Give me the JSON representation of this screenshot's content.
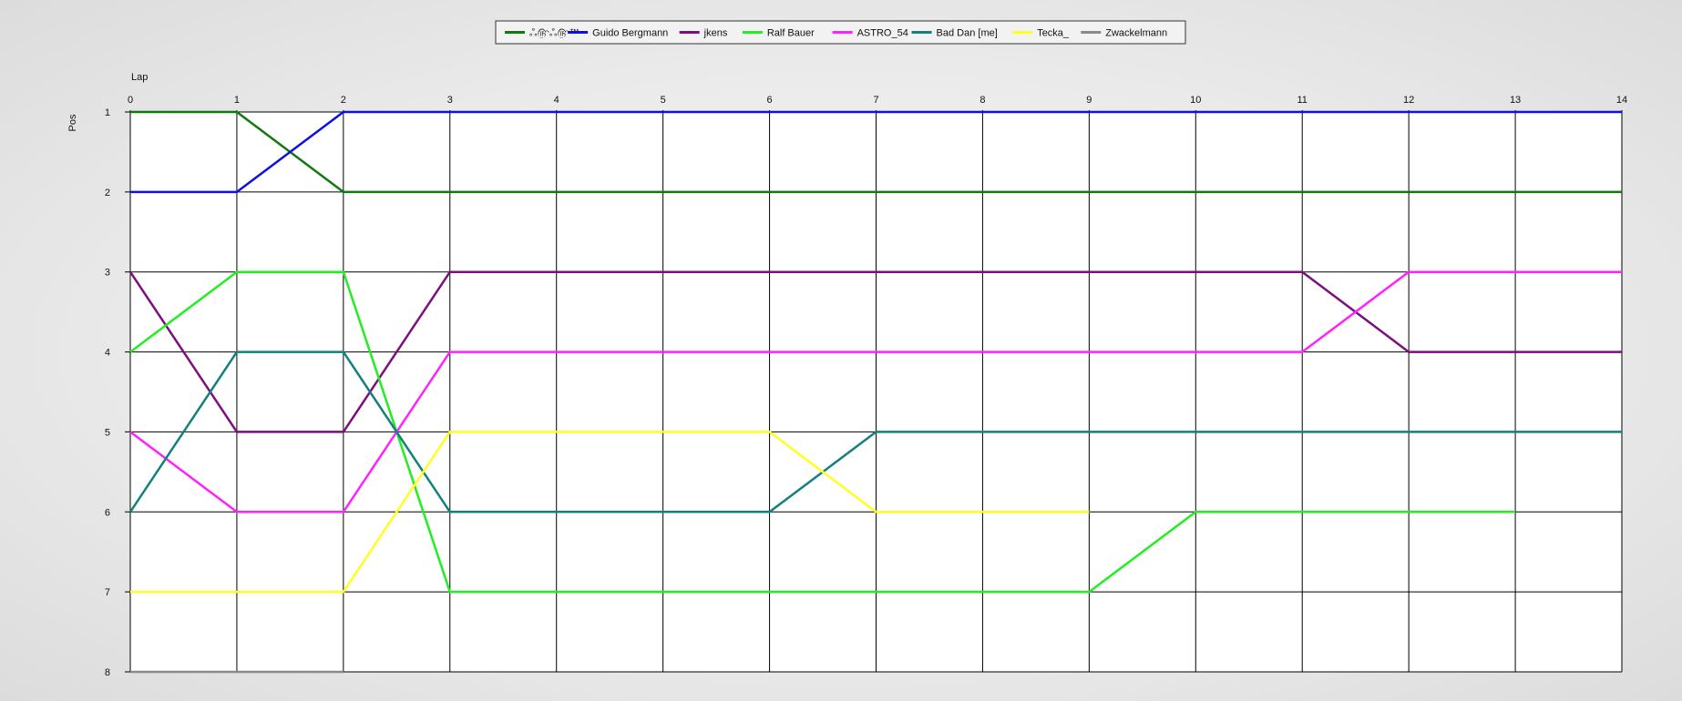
{
  "chart_data": {
    "type": "line",
    "xlabel": "Lap",
    "ylabel": "Pos",
    "xlim": [
      0,
      14
    ],
    "ylim": [
      1,
      8
    ],
    "y_inverted": true,
    "grid": true,
    "legend_position": "top-center",
    "x_ticks": [
      "0",
      "1",
      "2",
      "3",
      "4",
      "5",
      "6",
      "7",
      "8",
      "9",
      "10",
      "11",
      "12",
      "13",
      "14"
    ],
    "y_ticks": [
      "1",
      "2",
      "3",
      "4",
      "5",
      "6",
      "7",
      "8"
    ],
    "series": [
      {
        "name": "ஃ௹ஃ௹™",
        "color": "#0f7a0f",
        "x": [
          0,
          1,
          2,
          3,
          4,
          5,
          6,
          7,
          8,
          9,
          10,
          11,
          12,
          13,
          14
        ],
        "y": [
          1,
          1,
          2,
          2,
          2,
          2,
          2,
          2,
          2,
          2,
          2,
          2,
          2,
          2,
          2
        ]
      },
      {
        "name": "Guido Bergmann",
        "color": "#1010e0",
        "x": [
          0,
          1,
          2,
          3,
          4,
          5,
          6,
          7,
          8,
          9,
          10,
          11,
          12,
          13,
          14
        ],
        "y": [
          2,
          2,
          1,
          1,
          1,
          1,
          1,
          1,
          1,
          1,
          1,
          1,
          1,
          1,
          1
        ]
      },
      {
        "name": "jkens",
        "color": "#7d0f7d",
        "x": [
          0,
          1,
          2,
          3,
          4,
          5,
          6,
          7,
          8,
          9,
          10,
          11,
          12,
          13,
          14
        ],
        "y": [
          3,
          5,
          5,
          3,
          3,
          3,
          3,
          3,
          3,
          3,
          3,
          3,
          4,
          4,
          4
        ]
      },
      {
        "name": "Ralf Bauer",
        "color": "#22ee22",
        "x": [
          0,
          1,
          2,
          3,
          4,
          5,
          6,
          7,
          8,
          9,
          10,
          11,
          12,
          13
        ],
        "y": [
          4,
          3,
          3,
          7,
          7,
          7,
          7,
          7,
          7,
          7,
          6,
          6,
          6,
          6
        ]
      },
      {
        "name": "ASTRO_54",
        "color": "#ff22ff",
        "x": [
          0,
          1,
          2,
          3,
          4,
          5,
          6,
          7,
          8,
          9,
          10,
          11,
          12,
          13,
          14
        ],
        "y": [
          5,
          6,
          6,
          4,
          4,
          4,
          4,
          4,
          4,
          4,
          4,
          4,
          3,
          3,
          3
        ]
      },
      {
        "name": "Bad Dan [me]",
        "color": "#138080",
        "x": [
          0,
          1,
          2,
          3,
          4,
          5,
          6,
          7,
          8,
          9,
          10,
          11,
          12,
          13,
          14
        ],
        "y": [
          6,
          4,
          4,
          6,
          6,
          6,
          6,
          5,
          5,
          5,
          5,
          5,
          5,
          5,
          5
        ]
      },
      {
        "name": "Tecka_",
        "color": "#ffff22",
        "x": [
          0,
          1,
          2,
          3,
          4,
          5,
          6,
          7,
          8,
          9
        ],
        "y": [
          7,
          7,
          7,
          5,
          5,
          5,
          5,
          6,
          6,
          6
        ]
      },
      {
        "name": "Zwackelmann",
        "color": "#8a8a8a",
        "x": [
          0,
          1,
          2
        ],
        "y": [
          8,
          8,
          8
        ]
      }
    ]
  }
}
